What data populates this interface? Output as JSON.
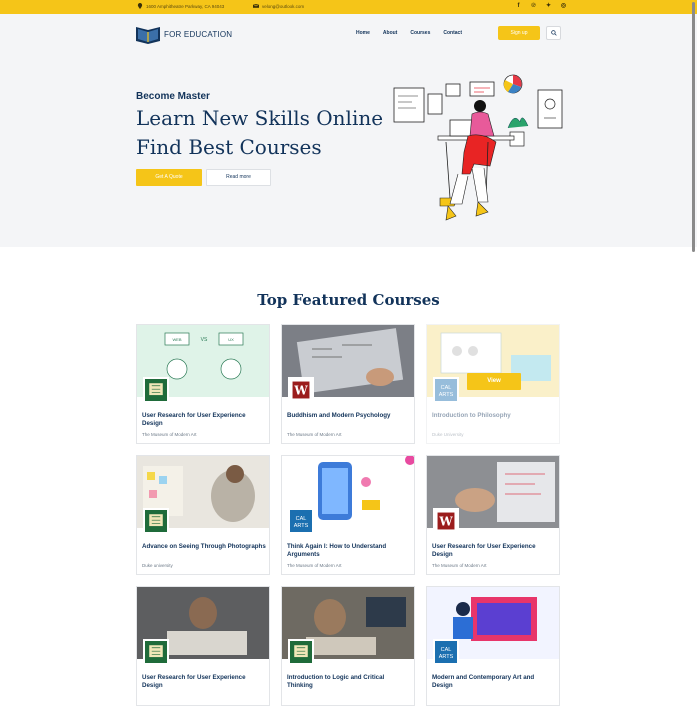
{
  "topbar": {
    "address": "1600 Amphitheatre Parkway, CA 94043",
    "email": "velong@outlook.com",
    "social": [
      "facebook-icon",
      "pinterest-icon",
      "twitter-icon",
      "instagram-icon"
    ]
  },
  "nav": {
    "logo_text": "FOR EDUCATION",
    "menu": [
      "Home",
      "About",
      "Courses",
      "Contact"
    ],
    "signup_label": "Sign up"
  },
  "hero": {
    "kicker": "Become Master",
    "title_line1": "Learn New Skills Online",
    "title_line2": "Find Best Courses",
    "cta_primary": "Get A Quote",
    "cta_secondary": "Read more"
  },
  "courses": {
    "section_title": "Top Featured Courses",
    "view_label": "View",
    "items": [
      {
        "title": "User Research for User Experience Design",
        "provider": "The Museum of Modern Art",
        "badge": "SEAL"
      },
      {
        "title": "Buddhism and Modern Psychology",
        "provider": "The Museum of Modern Art",
        "badge": "W"
      },
      {
        "title": "Introduction to Philosophy",
        "provider": "Duke University",
        "badge": "CAL ARTS"
      },
      {
        "title": "Advance on Seeing Through Photographs",
        "provider": "Duke university",
        "badge": "SEAL"
      },
      {
        "title": "Think Again I: How to Understand Arguments",
        "provider": "The Museum of Modern Art",
        "badge": "CAL ARTS"
      },
      {
        "title": "User Research for User Experience Design",
        "provider": "The Museum of Modern Art",
        "badge": "W"
      },
      {
        "title": "User Research for User Experience Design",
        "provider": "",
        "badge": "SEAL"
      },
      {
        "title": "Introduction to Logic and Critical Thinking",
        "provider": "",
        "badge": "SEAL"
      },
      {
        "title": "Modern and Contemporary Art and Design",
        "provider": "",
        "badge": "CAL ARTS"
      }
    ]
  },
  "colors": {
    "accent": "#f5c518",
    "navy": "#12335a",
    "hero_bg": "#f4f5f7"
  }
}
